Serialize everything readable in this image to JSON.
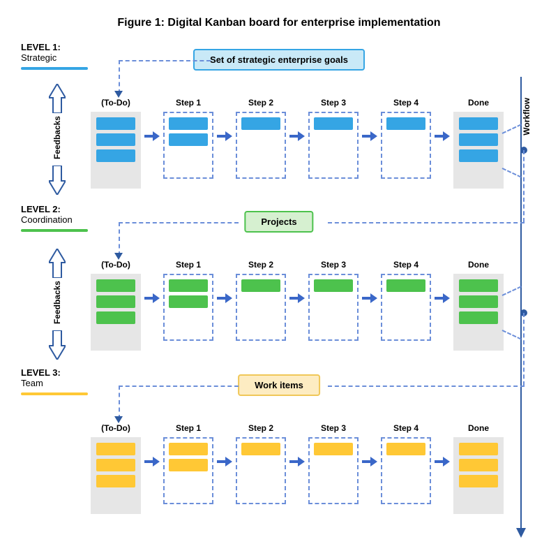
{
  "title": "Figure 1: Digital Kanban board for enterprise implementation",
  "workflow_label": "Workflow",
  "feedback_label": "Feedbacks",
  "column_labels": [
    "(To-Do)",
    "Step 1",
    "Step 2",
    "Step 3",
    "Step 4",
    "Done"
  ],
  "levels": [
    {
      "label": "LEVEL 1:",
      "name": "Strategic",
      "color": "blue",
      "tag": "Set of strategic enterprise goals",
      "columns": [
        3,
        2,
        1,
        1,
        1,
        3
      ]
    },
    {
      "label": "LEVEL 2:",
      "name": "Coordination",
      "color": "green",
      "tag": "Projects",
      "columns": [
        3,
        2,
        1,
        1,
        1,
        3
      ]
    },
    {
      "label": "LEVEL 3:",
      "name": "Team",
      "color": "yellow",
      "tag": "Work items",
      "columns": [
        3,
        2,
        1,
        1,
        1,
        3
      ]
    }
  ]
}
